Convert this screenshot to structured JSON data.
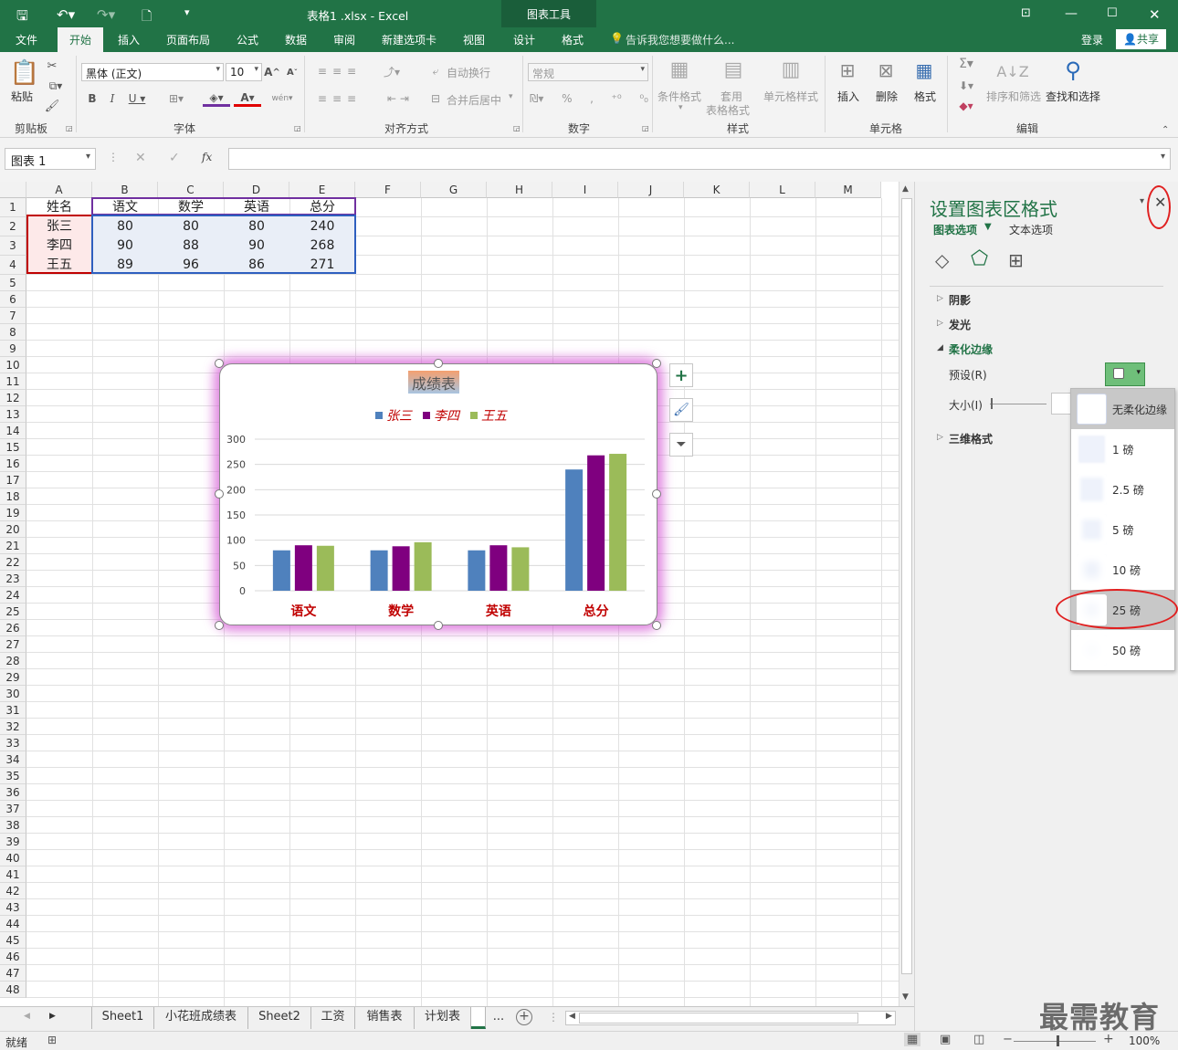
{
  "titlebar": {
    "title": "表格1 .xlsx - Excel",
    "context_tools": "图表工具"
  },
  "tabs": [
    "文件",
    "开始",
    "插入",
    "页面布局",
    "公式",
    "数据",
    "审阅",
    "新建选项卡",
    "视图",
    "设计",
    "格式"
  ],
  "tell_me": "告诉我您想要做什么...",
  "account": {
    "login": "登录",
    "share": "共享"
  },
  "ribbon": {
    "clipboard": {
      "paste": "粘贴",
      "group": "剪贴板"
    },
    "font": {
      "name": "黑体 (正文)",
      "size": "10",
      "group": "字体"
    },
    "alignment": {
      "wrap": "自动换行",
      "merge": "合并后居中",
      "group": "对齐方式"
    },
    "number": {
      "format": "常规",
      "group": "数字"
    },
    "styles": {
      "cond": "条件格式",
      "table1": "套用",
      "table2": "表格格式",
      "cell": "单元格样式",
      "group": "样式"
    },
    "cells": {
      "insert": "插入",
      "delete": "删除",
      "format": "格式",
      "group": "单元格"
    },
    "editing": {
      "sort": "排序和筛选",
      "find": "查找和选择",
      "group": "编辑"
    }
  },
  "formula_bar": {
    "name_box": "图表 1",
    "fx": "fx",
    "value": ""
  },
  "columns": [
    "A",
    "B",
    "C",
    "D",
    "E",
    "F",
    "G",
    "H",
    "I",
    "J",
    "K",
    "L",
    "M"
  ],
  "rows": [
    "1",
    "2",
    "3",
    "4",
    "5",
    "6",
    "7",
    "8",
    "9",
    "10",
    "11",
    "12",
    "13",
    "14",
    "15",
    "16",
    "17",
    "18",
    "19",
    "20",
    "21",
    "22",
    "23",
    "24",
    "25",
    "26",
    "27",
    "28",
    "29",
    "30",
    "31",
    "32",
    "33",
    "34",
    "35",
    "36",
    "37",
    "38",
    "39",
    "40",
    "41",
    "42",
    "43",
    "44",
    "45",
    "46",
    "47",
    "48"
  ],
  "table": {
    "header": [
      "姓名",
      "语文",
      "数学",
      "英语",
      "总分"
    ],
    "rows": [
      [
        "张三",
        "80",
        "80",
        "80",
        "240"
      ],
      [
        "李四",
        "90",
        "88",
        "90",
        "268"
      ],
      [
        "王五",
        "89",
        "96",
        "86",
        "271"
      ]
    ]
  },
  "chart_data": {
    "type": "bar",
    "title": "成绩表",
    "categories": [
      "语文",
      "数学",
      "英语",
      "总分"
    ],
    "series": [
      {
        "name": "张三",
        "values": [
          80,
          80,
          80,
          240
        ],
        "color": "#4f81bd"
      },
      {
        "name": "李四",
        "values": [
          90,
          88,
          90,
          268
        ],
        "color": "#7f007f"
      },
      {
        "name": "王五",
        "values": [
          89,
          96,
          86,
          271
        ],
        "color": "#9bbb59"
      }
    ],
    "ylim": [
      0,
      300
    ],
    "yticks": [
      "300",
      "250",
      "200",
      "150",
      "100",
      "50",
      "0"
    ],
    "grid": true,
    "legend": "top",
    "category_label_color": "#c00000"
  },
  "pane": {
    "title": "设置图表区格式",
    "tab_chart": "图表选项",
    "tab_text": "文本选项",
    "shadow": "阴影",
    "glow": "发光",
    "soft_edge": "柔化边缘",
    "preset": "预设(R)",
    "size": "大小(I)",
    "three_d": "三维格式"
  },
  "presets": [
    "无柔化边缘",
    "1 磅",
    "2.5 磅",
    "5 磅",
    "10 磅",
    "25 磅",
    "50 磅"
  ],
  "sheets": [
    "Sheet1",
    "小花班成绩表",
    "Sheet2",
    "工资",
    "销售表",
    "计划表",
    "...",
    "+"
  ],
  "status": {
    "ready": "就绪",
    "zoom": "100%"
  },
  "watermark": "最需教育"
}
